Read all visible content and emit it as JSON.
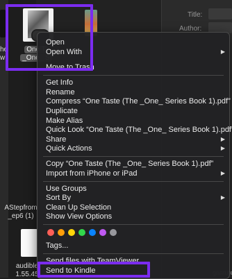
{
  "finder": {
    "info_title_label": "Title:",
    "info_author_label": "Author:",
    "selected_file_label_line1": "One T",
    "selected_file_label_line2": "_One_ S",
    "left_file_label_line1": "he",
    "left_file_label_line2": "w",
    "astep_label_line1": "AStepfrom",
    "astep_label_line2": "_ep6 (1)",
    "audible_label_line1": "audible",
    "audible_label_line2": "1.55.45",
    "bottom_right_text": "gnature"
  },
  "context_menu": {
    "group1": [
      {
        "label": "Open",
        "submenu": false
      },
      {
        "label": "Open With",
        "submenu": true
      },
      {
        "label": "Move to Trash",
        "submenu": false
      }
    ],
    "group2": [
      {
        "label": "Get Info",
        "submenu": false
      },
      {
        "label": "Rename",
        "submenu": false
      },
      {
        "label": "Compress “One Taste (The _One_ Series Book 1).pdf”",
        "submenu": false
      },
      {
        "label": "Duplicate",
        "submenu": false
      },
      {
        "label": "Make Alias",
        "submenu": false
      },
      {
        "label": "Quick Look “One Taste (The _One_ Series Book 1).pdf”",
        "submenu": false
      },
      {
        "label": "Share",
        "submenu": true
      },
      {
        "label": "Quick Actions",
        "submenu": true
      }
    ],
    "group3": [
      {
        "label": "Copy “One Taste (The _One_ Series Book 1).pdf”",
        "submenu": false
      },
      {
        "label": "Import from iPhone or iPad",
        "submenu": true
      }
    ],
    "group4": [
      {
        "label": "Use Groups",
        "submenu": false
      },
      {
        "label": "Sort By",
        "submenu": true
      },
      {
        "label": "Clean Up Selection",
        "submenu": false
      },
      {
        "label": "Show View Options",
        "submenu": false
      }
    ],
    "tag_colors": [
      "#ff5f57",
      "#ff9f0a",
      "#ffd60a",
      "#32d74b",
      "#0a84ff",
      "#bf5af2",
      "#98989d"
    ],
    "tags_label": "Tags...",
    "group5": [
      {
        "label": "Send files with TeamViewer",
        "submenu": false
      },
      {
        "label": "Send to Kindle",
        "submenu": false
      }
    ],
    "arrow_glyph": "▶"
  },
  "highlight_color": "#7b2cf0"
}
